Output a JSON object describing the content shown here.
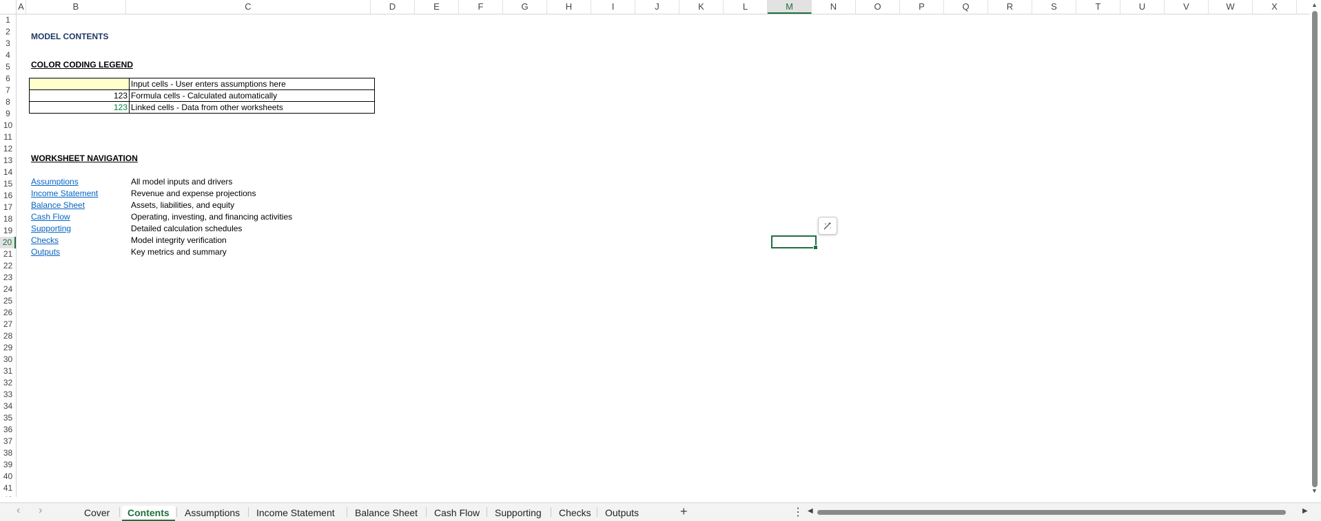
{
  "columns": [
    "A",
    "B",
    "C",
    "D",
    "E",
    "F",
    "G",
    "H",
    "I",
    "J",
    "K",
    "L",
    "M",
    "N",
    "O",
    "P",
    "Q",
    "R",
    "S",
    "T",
    "U",
    "V",
    "W",
    "X"
  ],
  "selected_column": "M",
  "row_count": 42,
  "selected_row": 20,
  "sheet": {
    "title": "MODEL CONTENTS",
    "legend_title": "COLOR CODING LEGEND",
    "legend": [
      {
        "sample": "",
        "description": "Input cells - User enters assumptions here"
      },
      {
        "sample": "123",
        "description": "Formula cells - Calculated automatically"
      },
      {
        "sample": "123",
        "description": "Linked cells - Data from other worksheets"
      }
    ],
    "nav_title": "WORKSHEET NAVIGATION",
    "nav": [
      {
        "link": "Assumptions",
        "description": "All model inputs and drivers"
      },
      {
        "link": "Income Statement",
        "description": "Revenue and expense projections"
      },
      {
        "link": "Balance Sheet",
        "description": "Assets, liabilities, and equity"
      },
      {
        "link": "Cash Flow",
        "description": "Operating, investing, and financing activities"
      },
      {
        "link": "Supporting",
        "description": "Detailed calculation schedules"
      },
      {
        "link": "Checks",
        "description": "Model integrity verification"
      },
      {
        "link": "Outputs",
        "description": "Key metrics and summary"
      }
    ]
  },
  "tabs": {
    "items": [
      "Cover",
      "Contents",
      "Assumptions",
      "Income Statement",
      "Balance Sheet",
      "Cash Flow",
      "Supporting",
      "Checks",
      "Outputs"
    ],
    "active": "Contents",
    "add_label": "+",
    "more_label": "⋮",
    "prev_label": "‹",
    "next_label": "›"
  },
  "colors": {
    "input_fill": "#ffffcc",
    "linked_text": "#00803a",
    "accent": "#1f6e3c",
    "link": "#0563c1",
    "title": "#1f3864"
  },
  "icons": {
    "quick_analysis": "quick-analysis-icon"
  }
}
